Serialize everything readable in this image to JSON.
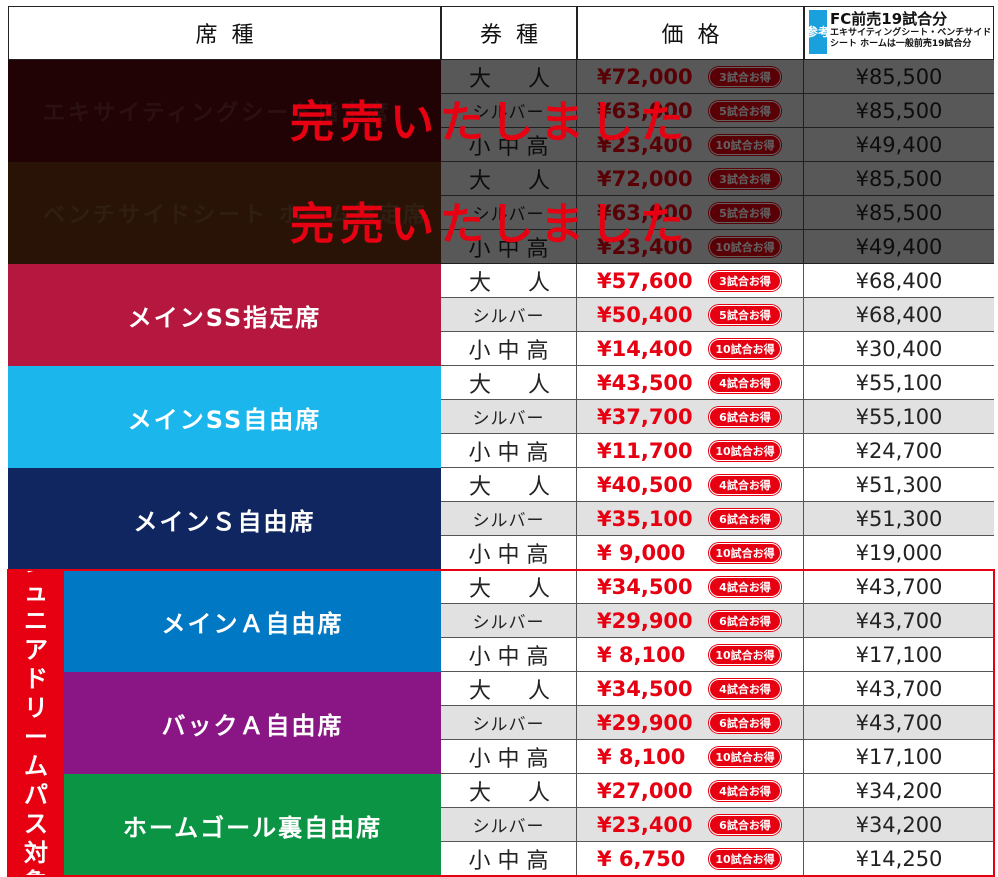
{
  "header": {
    "seat_col": "席種",
    "ticket_col": "券種",
    "price_col": "価格",
    "fc_badge": "参考",
    "fc_title": "FC前売19試合分",
    "fc_note1": "エキサイティングシート・ベンチサイド",
    "fc_note2": "シート ホームは一般前売19試合分"
  },
  "sold_out_label": "完売いたしました",
  "junior_dream_pass_label": "ジュニアドリームパス対象",
  "colors": {
    "accent_red": "#e60012",
    "excite": "#5a0a0e",
    "bench": "#6b3410",
    "main_ss_reserved": "#b5173f",
    "main_ss_free": "#1ab6ec",
    "main_s_free": "#0f2660",
    "main_a_free": "#0078c3",
    "back_a_free": "#8a1685",
    "home_goal": "#0b9444",
    "row_white": "#ffffff",
    "row_gray": "#e1e1e1"
  },
  "seats": [
    {
      "name": "エキサイティングシート指定席",
      "sold_out": true,
      "color": "#5a0a0e",
      "rows": [
        {
          "type": "大人",
          "price": "¥72,000",
          "badge": "3試合お得",
          "ref": "¥85,500"
        },
        {
          "type": "シルバー",
          "price": "¥63,000",
          "badge": "5試合お得",
          "ref": "¥85,500"
        },
        {
          "type": "小中高",
          "price": "¥23,400",
          "badge": "10試合お得",
          "ref": "¥49,400"
        }
      ]
    },
    {
      "name": "ベンチサイドシート ホーム指定席",
      "sold_out": true,
      "color": "#6b3410",
      "rows": [
        {
          "type": "大人",
          "price": "¥72,000",
          "badge": "3試合お得",
          "ref": "¥85,500"
        },
        {
          "type": "シルバー",
          "price": "¥63,000",
          "badge": "5試合お得",
          "ref": "¥85,500"
        },
        {
          "type": "小中高",
          "price": "¥23,400",
          "badge": "10試合お得",
          "ref": "¥49,400"
        }
      ]
    },
    {
      "name": "メインSS指定席",
      "sold_out": false,
      "color": "#b5173f",
      "rows": [
        {
          "type": "大人",
          "price": "¥57,600",
          "badge": "3試合お得",
          "ref": "¥68,400"
        },
        {
          "type": "シルバー",
          "price": "¥50,400",
          "badge": "5試合お得",
          "ref": "¥68,400"
        },
        {
          "type": "小中高",
          "price": "¥14,400",
          "badge": "10試合お得",
          "ref": "¥30,400"
        }
      ]
    },
    {
      "name": "メインSS自由席",
      "sold_out": false,
      "color": "#1ab6ec",
      "rows": [
        {
          "type": "大人",
          "price": "¥43,500",
          "badge": "4試合お得",
          "ref": "¥55,100"
        },
        {
          "type": "シルバー",
          "price": "¥37,700",
          "badge": "6試合お得",
          "ref": "¥55,100"
        },
        {
          "type": "小中高",
          "price": "¥11,700",
          "badge": "10試合お得",
          "ref": "¥24,700"
        }
      ]
    },
    {
      "name": "メインＳ自由席",
      "sold_out": false,
      "color": "#0f2660",
      "rows": [
        {
          "type": "大人",
          "price": "¥40,500",
          "badge": "4試合お得",
          "ref": "¥51,300"
        },
        {
          "type": "シルバー",
          "price": "¥35,100",
          "badge": "6試合お得",
          "ref": "¥51,300"
        },
        {
          "type": "小中高",
          "price": "¥ 9,000",
          "badge": "10試合お得",
          "ref": "¥19,000"
        }
      ]
    },
    {
      "name": "メインＡ自由席",
      "sold_out": false,
      "color": "#0078c3",
      "rows": [
        {
          "type": "大人",
          "price": "¥34,500",
          "badge": "4試合お得",
          "ref": "¥43,700"
        },
        {
          "type": "シルバー",
          "price": "¥29,900",
          "badge": "6試合お得",
          "ref": "¥43,700"
        },
        {
          "type": "小中高",
          "price": "¥ 8,100",
          "badge": "10試合お得",
          "ref": "¥17,100"
        }
      ]
    },
    {
      "name": "バックＡ自由席",
      "sold_out": false,
      "color": "#8a1685",
      "rows": [
        {
          "type": "大人",
          "price": "¥34,500",
          "badge": "4試合お得",
          "ref": "¥43,700"
        },
        {
          "type": "シルバー",
          "price": "¥29,900",
          "badge": "6試合お得",
          "ref": "¥43,700"
        },
        {
          "type": "小中高",
          "price": "¥ 8,100",
          "badge": "10試合お得",
          "ref": "¥17,100"
        }
      ]
    },
    {
      "name": "ホームゴール裏自由席",
      "sold_out": false,
      "color": "#0b9444",
      "rows": [
        {
          "type": "大人",
          "price": "¥27,000",
          "badge": "4試合お得",
          "ref": "¥34,200"
        },
        {
          "type": "シルバー",
          "price": "¥23,400",
          "badge": "6試合お得",
          "ref": "¥34,200"
        },
        {
          "type": "小中高",
          "price": "¥ 6,750",
          "badge": "10試合お得",
          "ref": "¥14,250"
        }
      ]
    }
  ]
}
